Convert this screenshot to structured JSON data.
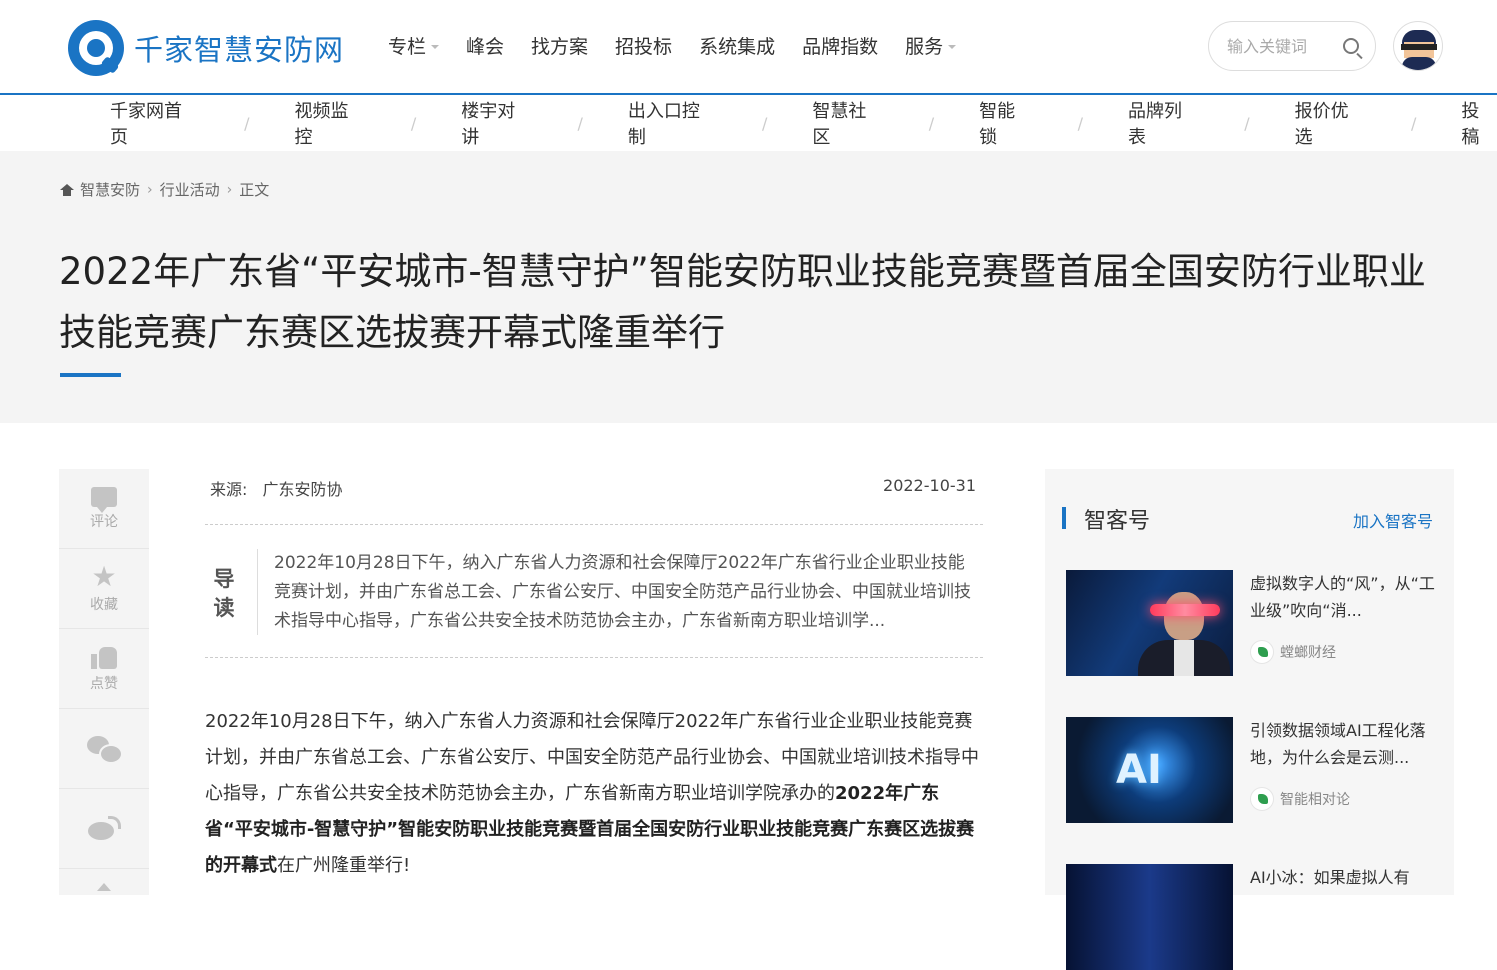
{
  "site": {
    "name": "千家智慧安防网"
  },
  "mainnav": [
    {
      "label": "专栏",
      "dropdown": true
    },
    {
      "label": "峰会",
      "dropdown": false
    },
    {
      "label": "找方案",
      "dropdown": false
    },
    {
      "label": "招投标",
      "dropdown": false
    },
    {
      "label": "系统集成",
      "dropdown": false
    },
    {
      "label": "品牌指数",
      "dropdown": false
    },
    {
      "label": "服务",
      "dropdown": true
    }
  ],
  "search": {
    "placeholder": "输入关键词"
  },
  "subnav": [
    "千家网首页",
    "视频监控",
    "楼宇对讲",
    "出入口控制",
    "智慧社区",
    "智能锁",
    "品牌列表",
    "报价优选",
    "投稿"
  ],
  "breadcrumb": {
    "home": "智慧安防",
    "section": "行业活动",
    "current": "正文"
  },
  "article": {
    "title": "2022年广东省“平安城市-智慧守护”智能安防职业技能竞赛暨首届全国安防行业职业技能竞赛广东赛区选拔赛开幕式隆重举行",
    "source_label": "来源:",
    "source": "广东安防协",
    "date": "2022-10-31",
    "summary_tag": "导读",
    "summary": "2022年10月28日下午，纳入广东省人力资源和社会保障厅2022年广东省行业企业职业技能竞赛计划，并由广东省总工会、广东省公安厅、中国安全防范产品行业协会、中国就业培训技术指导中心指导，广东省公共安全技术防范协会主办，广东省新南方职业培训学...",
    "body_plain": "2022年10月28日下午，纳入广东省人力资源和社会保障厅2022年广东省行业企业职业技能竞赛计划，并由广东省总工会、广东省公安厅、中国安全防范产品行业协会、中国就业培训技术指导中心指导，广东省公共安全技术防范协会主办，广东省新南方职业培训学院承办的",
    "body_bold": "2022年广东省“平安城市-智慧守护”智能安防职业技能竞赛暨首届全国安防行业职业技能竞赛广东赛区选拔赛的开幕式",
    "body_tail": "在广州隆重举行!"
  },
  "rail": {
    "comment": "评论",
    "favorite": "收藏",
    "like": "点赞"
  },
  "sidebar": {
    "heading": "智客号",
    "join_label": "加入智客号",
    "cards": [
      {
        "title": "虚拟数字人的“风”，从“工业级”吹向“消...",
        "source": "螳螂财经"
      },
      {
        "title": "引领数据领域AI工程化落地，为什么会是云测...",
        "source": "智能相对论"
      },
      {
        "title": "AI小冰：如果虚拟人有",
        "source": ""
      }
    ]
  },
  "colors": {
    "accent": "#1a74c4",
    "hero_bg": "#f4f4f4"
  }
}
